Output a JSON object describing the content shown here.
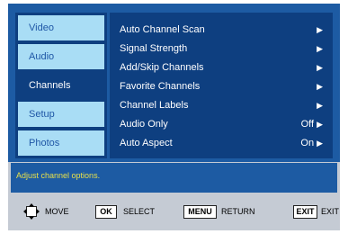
{
  "sidebar": {
    "items": [
      {
        "label": "Video",
        "selected": false
      },
      {
        "label": "Audio",
        "selected": false
      },
      {
        "label": "Channels",
        "selected": true
      },
      {
        "label": "Setup",
        "selected": false
      },
      {
        "label": "Photos",
        "selected": false
      }
    ]
  },
  "menu": {
    "items": [
      {
        "label": "Auto Channel Scan",
        "value": ""
      },
      {
        "label": "Signal Strength",
        "value": ""
      },
      {
        "label": "Add/Skip Channels",
        "value": ""
      },
      {
        "label": "Favorite Channels",
        "value": ""
      },
      {
        "label": "Channel Labels",
        "value": ""
      },
      {
        "label": "Audio Only",
        "value": "Off"
      },
      {
        "label": "Auto Aspect",
        "value": "On"
      }
    ],
    "arrow": "▶"
  },
  "status": {
    "text": "Adjust channel options."
  },
  "footer": {
    "move_label": "MOVE",
    "ok_key": "OK",
    "select_label": "SELECT",
    "menu_key": "MENU",
    "return_label": "RETURN",
    "exit_key": "EXIT",
    "exit_label": "EXIT"
  },
  "colors": {
    "frame_blue": "#1d5ba3",
    "panel_navy": "#0e3f80",
    "tab_light": "#a9ddf5",
    "status_text": "#e8e04a",
    "bar_gray": "#c5cbd4"
  },
  "icons": {
    "move": "four-way-arrow-icon",
    "submenu": "triangle-right-icon"
  }
}
